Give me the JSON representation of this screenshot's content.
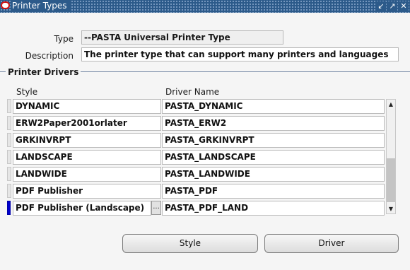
{
  "window": {
    "title": "Printer Types",
    "controls": [
      "minimize-icon",
      "maximize-icon",
      "close-icon"
    ]
  },
  "header": {
    "type_label": "Type",
    "type_value": "--PASTA Universal Printer Type",
    "description_label": "Description",
    "description_value": "The printer type that can support many printers and languages"
  },
  "drivers": {
    "group_title": "Printer Drivers",
    "columns": {
      "style": "Style",
      "driver_name": "Driver Name"
    },
    "rows": [
      {
        "style": "DYNAMIC",
        "driver": "PASTA_DYNAMIC"
      },
      {
        "style": "ERW2Paper2001orlater",
        "driver": "PASTA_ERW2"
      },
      {
        "style": "GRKINVRPT",
        "driver": "PASTA_GRKINVRPT"
      },
      {
        "style": "LANDSCAPE",
        "driver": "PASTA_LANDSCAPE"
      },
      {
        "style": "LANDWIDE",
        "driver": "PASTA_LANDWIDE"
      },
      {
        "style": "PDF Publisher",
        "driver": "PASTA_PDF"
      },
      {
        "style": "PDF Publisher (Landscape)",
        "driver": "PASTA_PDF_LAND"
      }
    ],
    "lov_button": "..."
  },
  "buttons": {
    "style": "Style",
    "driver": "Driver"
  },
  "colors": {
    "titlebar": "#2c5a8a",
    "active_row": "#0000cc"
  }
}
